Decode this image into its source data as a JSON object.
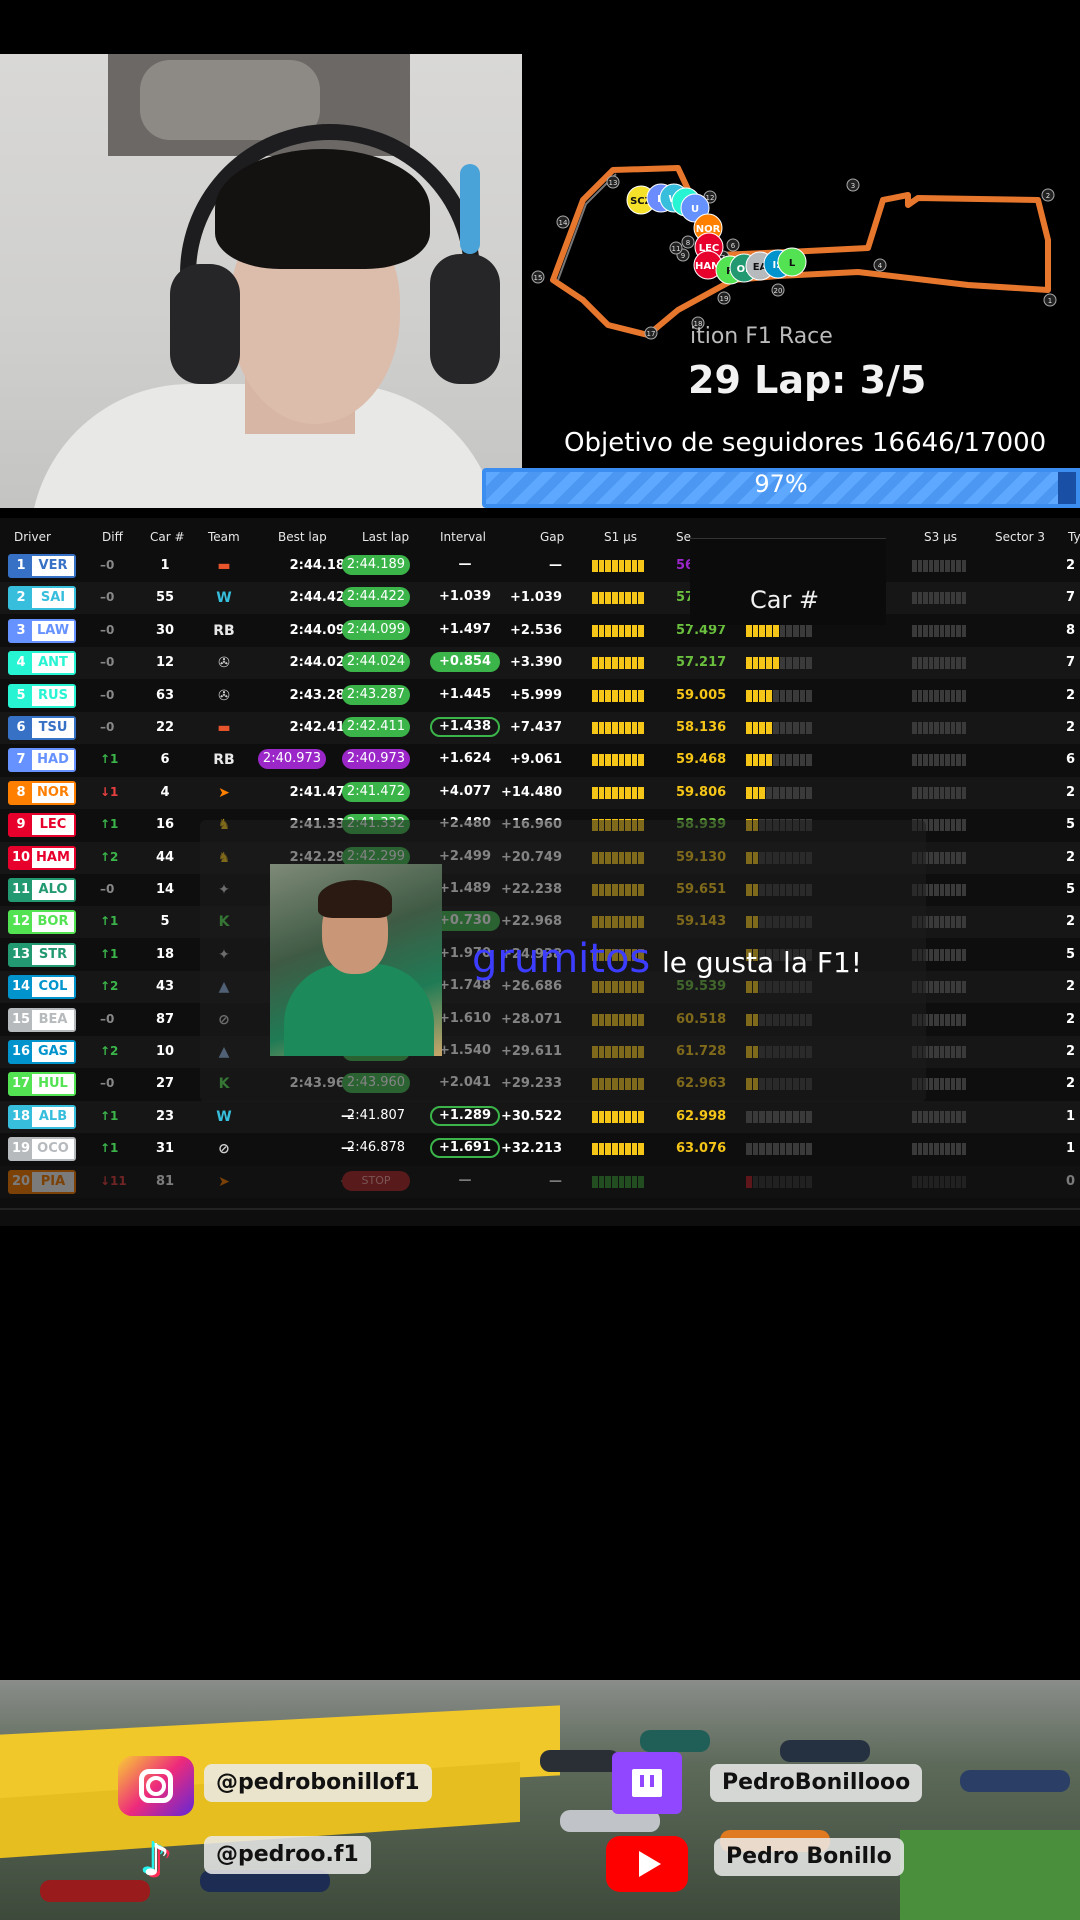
{
  "overlay": {
    "lap_text": "29 Lap: 3/5",
    "race_label": "ition F1 Race",
    "follower_goal": "Objetivo de seguidores  16646/17000",
    "follower_goal_progress": 0.97,
    "follower_goal_pct": "97%"
  },
  "trackmap": {
    "markers": [
      "SCZ",
      "R",
      "W",
      "S",
      "U",
      "NOR",
      "LEC",
      "HAM",
      "R",
      "OL",
      "EA",
      "IS",
      "L"
    ],
    "turns": [
      "1",
      "2",
      "3",
      "4",
      "5",
      "6",
      "7",
      "8",
      "9",
      "10",
      "11",
      "12",
      "13",
      "14",
      "15",
      "16",
      "17",
      "18",
      "19",
      "20"
    ]
  },
  "timing": {
    "headers": {
      "driver": "Driver",
      "diff": "Diff",
      "car": "Car #",
      "team": "Team",
      "best": "Best lap",
      "last": "Last lap",
      "interval": "Interval",
      "gap": "Gap",
      "s1": "S1 µs",
      "s2": "Se",
      "s3": "S3 µs",
      "sector3": "Sector 3",
      "extra": "Ty"
    },
    "rows": [
      {
        "pos": "1",
        "code": "VER",
        "color": "#3671c6",
        "diff": "–0",
        "diff_color": "#888",
        "car": "1",
        "team_icon": "redbull-icon",
        "team_glyph": "▬",
        "team_color": "#e8542b",
        "best": "2:44.189",
        "last": "2:44.189",
        "last_style": "green",
        "interval": "—",
        "interval_style": "plain",
        "gap": "—",
        "s1": "",
        "s2": "56.",
        "s2_color": "#9b27c9",
        "s3_level": 0,
        "far": "2"
      },
      {
        "pos": "2",
        "code": "SAI",
        "color": "#37bedd",
        "diff": "–0",
        "diff_color": "#888",
        "car": "55",
        "team_icon": "williams-icon",
        "team_glyph": "W",
        "team_color": "#37bedd",
        "best": "2:44.422",
        "last": "2:44.422",
        "last_style": "green",
        "interval": "+1.039",
        "interval_style": "plain",
        "gap": "+1.039",
        "s2": "57.",
        "s2_color": "#6abf3e",
        "s3_level": 0,
        "far": "7"
      },
      {
        "pos": "3",
        "code": "LAW",
        "color": "#6692ff",
        "diff": "–0",
        "diff_color": "#888",
        "car": "30",
        "team_icon": "racingbulls-icon",
        "team_glyph": "RB",
        "team_color": "#e8e8e8",
        "best": "2:44.099",
        "last": "2:44.099",
        "last_style": "green",
        "interval": "+1.497",
        "interval_style": "plain",
        "gap": "+2.536",
        "s2": "57.497",
        "s2_color": "#6abf3e",
        "s3_level": 5,
        "far": "8"
      },
      {
        "pos": "4",
        "code": "ANT",
        "color": "#27f4d2",
        "diff": "–0",
        "diff_color": "#888",
        "car": "12",
        "team_icon": "mercedes-icon",
        "team_glyph": "✇",
        "team_color": "#cfcfcf",
        "best": "2:44.024",
        "last": "2:44.024",
        "last_style": "green",
        "interval": "+0.854",
        "interval_style": "fill",
        "gap": "+3.390",
        "s2": "57.217",
        "s2_color": "#6abf3e",
        "s3_level": 5,
        "far": "7"
      },
      {
        "pos": "5",
        "code": "RUS",
        "color": "#27f4d2",
        "diff": "–0",
        "diff_color": "#888",
        "car": "63",
        "team_icon": "mercedes-icon",
        "team_glyph": "✇",
        "team_color": "#cfcfcf",
        "best": "2:43.287",
        "last": "2:43.287",
        "last_style": "green",
        "interval": "+1.445",
        "interval_style": "plain",
        "gap": "+5.999",
        "s2": "59.005",
        "s2_color": "#f5c518",
        "s3_level": 4,
        "far": "2"
      },
      {
        "pos": "6",
        "code": "TSU",
        "color": "#3671c6",
        "diff": "–0",
        "diff_color": "#888",
        "car": "22",
        "team_icon": "redbull-icon",
        "team_glyph": "▬",
        "team_color": "#e8542b",
        "best": "2:42.411",
        "last": "2:42.411",
        "last_style": "green",
        "interval": "+1.438",
        "interval_style": "box",
        "gap": "+7.437",
        "s2": "58.136",
        "s2_color": "#f5c518",
        "s3_level": 4,
        "far": "2"
      },
      {
        "pos": "7",
        "code": "HAD",
        "color": "#6692ff",
        "diff": "↑1",
        "diff_color": "#3bb54a",
        "car": "6",
        "team_icon": "racingbulls-icon",
        "team_glyph": "RB",
        "team_color": "#e8e8e8",
        "best": "2:40.973",
        "best_style": "purple",
        "last": "2:40.973",
        "last_style": "purple",
        "interval": "+1.624",
        "interval_style": "plain",
        "gap": "+9.061",
        "s2": "59.468",
        "s2_color": "#f5c518",
        "s3_level": 4,
        "far": "6"
      },
      {
        "pos": "8",
        "code": "NOR",
        "color": "#ff8000",
        "diff": "↓1",
        "diff_color": "#e84040",
        "car": "4",
        "team_icon": "mclaren-icon",
        "team_glyph": "➤",
        "team_color": "#ff8000",
        "best": "2:41.472",
        "last": "2:41.472",
        "last_style": "green",
        "interval": "+4.077",
        "interval_style": "plain",
        "gap": "+14.480",
        "s2": "59.806",
        "s2_color": "#f5c518",
        "s3_level": 3,
        "far": "2"
      },
      {
        "pos": "9",
        "code": "LEC",
        "color": "#e8002d",
        "diff": "↑1",
        "diff_color": "#3bb54a",
        "car": "16",
        "team_icon": "ferrari-icon",
        "team_glyph": "♞",
        "team_color": "#f5c518",
        "best": "2:41.332",
        "last": "2:41.332",
        "last_style": "green",
        "interval": "+2.480",
        "interval_style": "plain",
        "gap": "+16.960",
        "s2": "58.939",
        "s2_color": "#6abf3e",
        "s3_level": 2,
        "far": "5"
      },
      {
        "pos": "10",
        "code": "HAM",
        "color": "#e8002d",
        "diff": "↑2",
        "diff_color": "#3bb54a",
        "car": "44",
        "team_icon": "ferrari-icon",
        "team_glyph": "♞",
        "team_color": "#f5c518",
        "best": "2:42.299",
        "last": "2:42.299",
        "last_style": "green",
        "interval": "+2.499",
        "interval_style": "plain",
        "gap": "+20.749",
        "s2": "59.130",
        "s2_color": "#f5c518",
        "s3_level": 2,
        "far": "2"
      },
      {
        "pos": "11",
        "code": "ALO",
        "color": "#229971",
        "diff": "–0",
        "diff_color": "#888",
        "car": "14",
        "team_icon": "astonmartin-icon",
        "team_glyph": "✦",
        "team_color": "#cfcfcf",
        "best": "",
        "last": "",
        "last_style": "plain",
        "interval": "+1.489",
        "interval_style": "plain",
        "gap": "+22.238",
        "s2": "59.651",
        "s2_color": "#f5c518",
        "s3_level": 2,
        "far": "5"
      },
      {
        "pos": "12",
        "code": "BOR",
        "color": "#52e252",
        "diff": "↑1",
        "diff_color": "#3bb54a",
        "car": "5",
        "team_icon": "sauber-icon",
        "team_glyph": "K",
        "team_color": "#52e252",
        "best": "",
        "last": "",
        "last_style": "plain",
        "interval": "+0.730",
        "interval_style": "fill",
        "gap": "+22.968",
        "s2": "59.143",
        "s2_color": "#f5c518",
        "s3_level": 2,
        "far": "2"
      },
      {
        "pos": "13",
        "code": "STR",
        "color": "#229971",
        "diff": "↑1",
        "diff_color": "#3bb54a",
        "car": "18",
        "team_icon": "astonmartin-icon",
        "team_glyph": "✦",
        "team_color": "#cfcfcf",
        "best": "",
        "last": "",
        "last_style": "plain",
        "interval": "+1.970",
        "interval_style": "plain",
        "gap": "+24.938",
        "s2": "",
        "s2_color": "#f5c518",
        "s3_level": 2,
        "far": "5"
      },
      {
        "pos": "14",
        "code": "COL",
        "color": "#0093cc",
        "diff": "↑2",
        "diff_color": "#3bb54a",
        "car": "43",
        "team_icon": "alpine-icon",
        "team_glyph": "▲",
        "team_color": "#8fb3e0",
        "best": "",
        "last": "",
        "last_style": "plain",
        "interval": "+1.748",
        "interval_style": "plain",
        "gap": "+26.686",
        "s2": "59.539",
        "s2_color": "#6abf3e",
        "s3_level": 2,
        "far": "2"
      },
      {
        "pos": "15",
        "code": "BEA",
        "color": "#b6babd",
        "diff": "–0",
        "diff_color": "#888",
        "car": "87",
        "team_icon": "haas-icon",
        "team_glyph": "⊘",
        "team_color": "#cfcfcf",
        "best": "",
        "last": "",
        "last_style": "plain",
        "interval": "+1.610",
        "interval_style": "plain",
        "gap": "+28.071",
        "s2": "60.518",
        "s2_color": "#f5c518",
        "s3_level": 2,
        "far": "2"
      },
      {
        "pos": "16",
        "code": "GAS",
        "color": "#0093cc",
        "diff": "↑2",
        "diff_color": "#3bb54a",
        "car": "10",
        "team_icon": "alpine-icon",
        "team_glyph": "▲",
        "team_color": "#8fb3e0",
        "best": "2:43.361",
        "last": "2:43.361",
        "last_style": "green",
        "interval": "+1.540",
        "interval_style": "plain",
        "gap": "+29.611",
        "s2": "61.728",
        "s2_color": "#f5c518",
        "s3_level": 2,
        "far": "2"
      },
      {
        "pos": "17",
        "code": "HUL",
        "color": "#52e252",
        "diff": "–0",
        "diff_color": "#888",
        "car": "27",
        "team_icon": "sauber-icon",
        "team_glyph": "K",
        "team_color": "#52e252",
        "best": "2:43.960",
        "last": "2:43.960",
        "last_style": "green",
        "interval": "+2.041",
        "interval_style": "plain",
        "gap": "+29.233",
        "s2": "62.963",
        "s2_color": "#f5c518",
        "s3_level": 2,
        "far": "2"
      },
      {
        "pos": "18",
        "code": "ALB",
        "color": "#37bedd",
        "diff": "↑1",
        "diff_color": "#3bb54a",
        "car": "23",
        "team_icon": "williams-icon",
        "team_glyph": "W",
        "team_color": "#37bedd",
        "best": "—",
        "last": "2:41.807",
        "last_style": "plain",
        "interval": "+1.289",
        "interval_style": "box",
        "gap": "+30.522",
        "s2": "62.998",
        "s2_color": "#f5c518",
        "s3_level": 0,
        "far": "1"
      },
      {
        "pos": "19",
        "code": "OCO",
        "color": "#b6babd",
        "diff": "↑1",
        "diff_color": "#3bb54a",
        "car": "31",
        "team_icon": "haas-icon",
        "team_glyph": "⊘",
        "team_color": "#cfcfcf",
        "best": "—",
        "last": "2:46.878",
        "last_style": "plain",
        "interval": "+1.691",
        "interval_style": "box",
        "gap": "+32.213",
        "s2": "63.076",
        "s2_color": "#f5c518",
        "s3_level": 0,
        "far": "1"
      },
      {
        "pos": "20",
        "code": "PIA",
        "color": "#ff8000",
        "diff": "↓11",
        "diff_color": "#e84040",
        "car": "81",
        "team_icon": "mclaren-icon",
        "team_glyph": "➤",
        "team_color": "#ff8000",
        "best": "—",
        "last": "STOP",
        "last_style": "stop",
        "interval": "—",
        "interval_style": "plain",
        "gap": "—",
        "s2": "",
        "s2_color": "#f5c518",
        "s3_level": 1,
        "far": "0",
        "dim": true
      }
    ]
  },
  "popup": {
    "label": "Car #"
  },
  "chat": {
    "username": "grumitos",
    "message": "le gusta la F1!"
  },
  "socials": {
    "instagram": "@pedrobonillof1",
    "tiktok": "@pedroo.f1",
    "twitch": "PedroBonillooo",
    "youtube": "Pedro Bonillo"
  },
  "colors": {
    "accent": "#3b8df0",
    "purple": "#9b27c9",
    "green": "#3bb54a",
    "chat_user": "#3d3dff"
  }
}
